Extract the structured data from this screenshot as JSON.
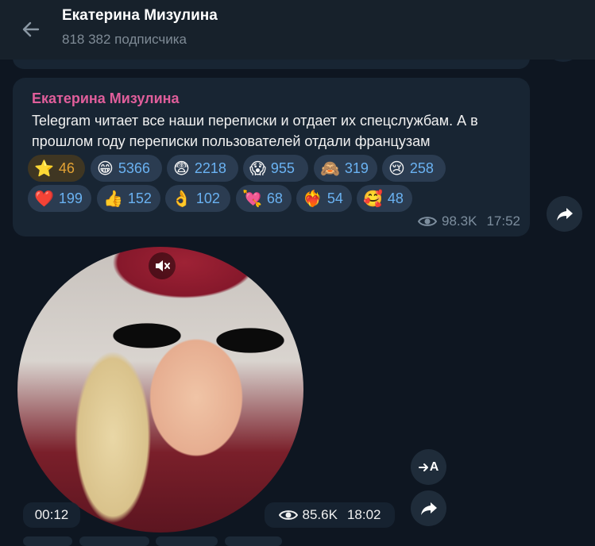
{
  "header": {
    "title": "Екатерина Мизулина",
    "subtitle": "818 382 подписчика"
  },
  "post": {
    "sender": "Екатерина Мизулина",
    "text": "Telegram читает все наши переписки и отдает их спецслужбам. А в прошлом году переписки пользователей отдали французам",
    "reactions_row1": [
      {
        "emoji": "⭐",
        "count": "46",
        "paid": true
      },
      {
        "emoji": "😁",
        "count": "5366"
      },
      {
        "emoji": "😨",
        "count": "2218"
      },
      {
        "emoji": "😱",
        "count": "955"
      },
      {
        "emoji": "🙈",
        "count": "319"
      },
      {
        "emoji": "😢",
        "count": "258"
      }
    ],
    "reactions_row2": [
      {
        "emoji": "❤️",
        "count": "199"
      },
      {
        "emoji": "👍",
        "count": "152"
      },
      {
        "emoji": "👌",
        "count": "102"
      },
      {
        "emoji": "💘",
        "count": "68"
      },
      {
        "emoji": "❤️‍🔥",
        "count": "54"
      },
      {
        "emoji": "🥰",
        "count": "48"
      }
    ],
    "views": "98.3K",
    "time": "17:52"
  },
  "video": {
    "duration": "00:12",
    "views": "85.6K",
    "time": "18:02",
    "translate_label": "A",
    "muted_icon": "muted-speaker-icon"
  },
  "colors": {
    "background": "#0e1621",
    "bubble": "#182533",
    "sender": "#e05e9b",
    "reaction_count": "#6ab2f2",
    "paid_star": "#e3a234"
  }
}
